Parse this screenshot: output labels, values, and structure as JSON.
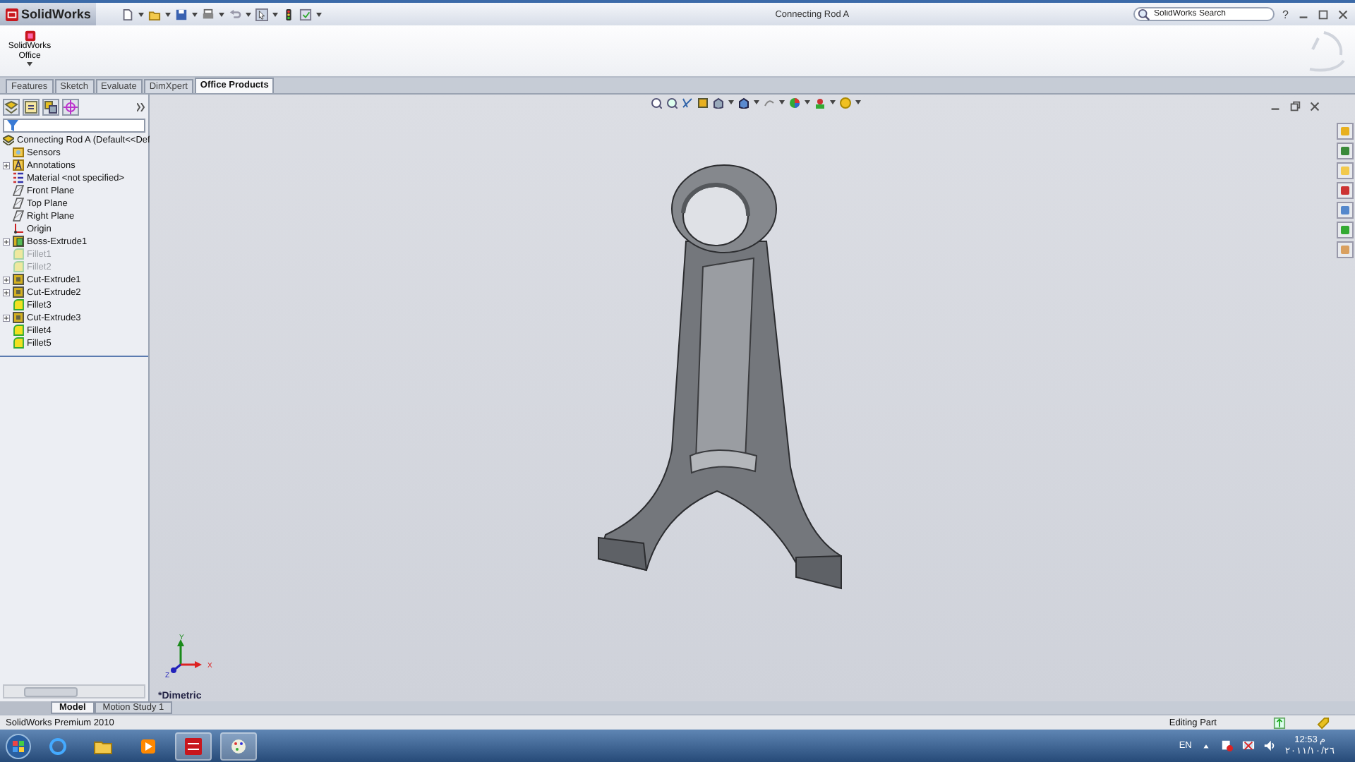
{
  "title_bar": {
    "app_name": "SolidWorks",
    "title": "Connecting Rod A",
    "search": {
      "placeholder": "SolidWorks Search"
    },
    "help": "?"
  },
  "ribbon": {
    "buttons": [
      {
        "label": "SolidWorks Office"
      }
    ]
  },
  "command_tabs": [
    {
      "label": "Features",
      "selected": false
    },
    {
      "label": "Sketch",
      "selected": false
    },
    {
      "label": "Evaluate",
      "selected": false
    },
    {
      "label": "DimXpert",
      "selected": false
    },
    {
      "label": "Office Products",
      "selected": true
    }
  ],
  "feature_tree": {
    "root": {
      "label": "Connecting Rod A  (Default<<Def",
      "children": [
        {
          "label": "Sensors",
          "kind": "sensor",
          "collapsed": false,
          "suppressed": false
        },
        {
          "label": "Annotations",
          "kind": "annotation",
          "collapsed": true,
          "suppressed": false
        },
        {
          "label": "Material <not specified>",
          "kind": "material",
          "collapsed": false,
          "suppressed": false
        },
        {
          "label": "Front Plane",
          "kind": "plane",
          "collapsed": false,
          "suppressed": false
        },
        {
          "label": "Top Plane",
          "kind": "plane",
          "collapsed": false,
          "suppressed": false
        },
        {
          "label": "Right Plane",
          "kind": "plane",
          "collapsed": false,
          "suppressed": false
        },
        {
          "label": "Origin",
          "kind": "origin",
          "collapsed": false,
          "suppressed": false
        },
        {
          "label": "Boss-Extrude1",
          "kind": "extrude",
          "collapsed": true,
          "suppressed": false
        },
        {
          "label": "Fillet1",
          "kind": "fillet",
          "collapsed": false,
          "suppressed": true
        },
        {
          "label": "Fillet2",
          "kind": "fillet",
          "collapsed": false,
          "suppressed": true
        },
        {
          "label": "Cut-Extrude1",
          "kind": "cut",
          "collapsed": true,
          "suppressed": false
        },
        {
          "label": "Cut-Extrude2",
          "kind": "cut",
          "collapsed": true,
          "suppressed": false
        },
        {
          "label": "Fillet3",
          "kind": "fillet",
          "collapsed": false,
          "suppressed": false
        },
        {
          "label": "Cut-Extrude3",
          "kind": "cut",
          "collapsed": true,
          "suppressed": false
        },
        {
          "label": "Fillet4",
          "kind": "fillet",
          "collapsed": false,
          "suppressed": false
        },
        {
          "label": "Fillet5",
          "kind": "fillet",
          "collapsed": false,
          "suppressed": false
        }
      ]
    }
  },
  "viewport": {
    "view_label": "*Dimetric",
    "axes": [
      "Y",
      "X",
      "Z"
    ]
  },
  "bottom_tabs": [
    {
      "label": "Model",
      "selected": true
    },
    {
      "label": "Motion Study 1",
      "selected": false
    }
  ],
  "status_bar": {
    "product": "SolidWorks Premium 2010",
    "mode": "Editing Part"
  },
  "taskbar": {
    "language": "EN",
    "time": "12:53 م",
    "date": "٢٠١١/١٠/٢٦"
  }
}
